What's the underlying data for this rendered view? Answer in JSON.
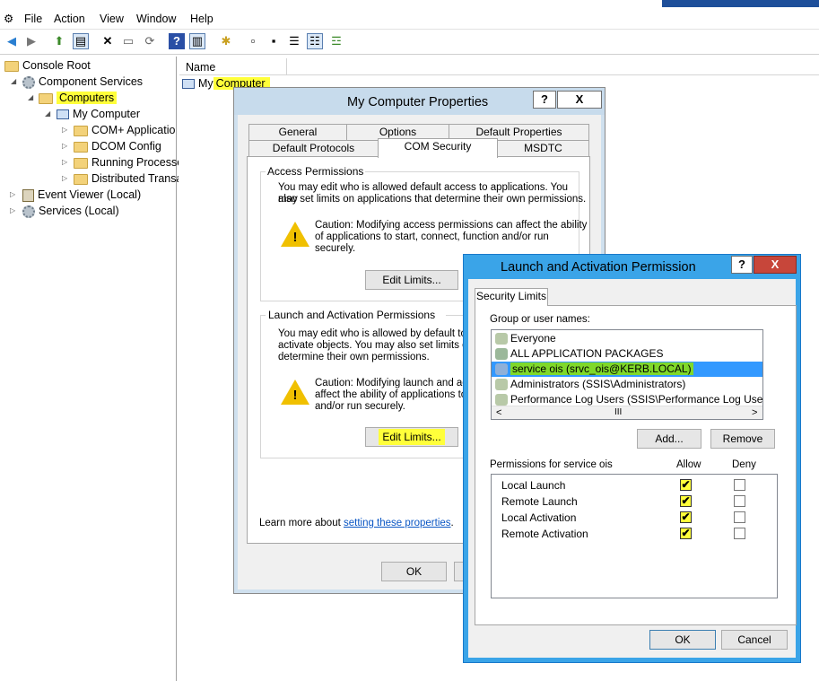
{
  "menu": {
    "file": "File",
    "action": "Action",
    "view": "View",
    "window": "Window",
    "help": "Help"
  },
  "tree": {
    "root": "Console Root",
    "component_services": "Component Services",
    "computers": "Computers",
    "my_computer": "My Computer",
    "com_apps": "COM+ Applicatio",
    "dcom_config": "DCOM Config",
    "running_processes": "Running Processe",
    "distributed_trans": "Distributed Transa",
    "event_viewer": "Event Viewer (Local)",
    "services": "Services (Local)"
  },
  "list": {
    "col_name": "Name",
    "row_my": "My",
    "row_computer": "Computer"
  },
  "props": {
    "title": "My Computer Properties",
    "help": "?",
    "close": "X",
    "tabs_top": [
      "General",
      "Options",
      "Default Properties"
    ],
    "tabs_bottom": [
      "Default Protocols",
      "COM Security",
      "MSDTC"
    ],
    "access_title": "Access Permissions",
    "access_text1": "You may edit who is allowed default access to applications. You may",
    "access_text2": "also set limits on applications that determine their own permissions.",
    "access_caution1": "Caution: Modifying access permissions can affect the ability",
    "access_caution2": "of applications to start, connect, function and/or run",
    "access_caution3": "securely.",
    "edit_limits": "Edit Limits...",
    "launch_title": "Launch and Activation Permissions",
    "launch_text1": "You may edit who is allowed by default to lau",
    "launch_text2": "activate objects. You may also set limits on a",
    "launch_text3": "determine their own permissions.",
    "launch_caution1": "Caution: Modifying launch and acti",
    "launch_caution2": "affect the ability of applications to s",
    "launch_caution3": "and/or run securely.",
    "learn_prefix": "Learn more about ",
    "learn_link": "setting these properties",
    "learn_suffix": ".",
    "ok": "OK"
  },
  "launch": {
    "title": "Launch and Activation Permission",
    "help": "?",
    "close": "X",
    "tab": "Security Limits",
    "group_label": "Group or user names:",
    "users": [
      "Everyone",
      "ALL APPLICATION PACKAGES",
      "service ois (srvc_ois@KERB.LOCAL)",
      "Administrators (SSIS\\Administrators)",
      "Performance Log Users (SSIS\\Performance Log Users)"
    ],
    "add": "Add...",
    "remove": "Remove",
    "perm_label": "Permissions for service ois",
    "allow": "Allow",
    "deny": "Deny",
    "perms": [
      {
        "name": "Local Launch",
        "allow": true,
        "deny": false
      },
      {
        "name": "Remote Launch",
        "allow": true,
        "deny": false
      },
      {
        "name": "Local Activation",
        "allow": true,
        "deny": false
      },
      {
        "name": "Remote Activation",
        "allow": true,
        "deny": false
      }
    ],
    "ok": "OK",
    "cancel": "Cancel",
    "scroll_up": "˄",
    "scroll_down": "˅",
    "scroll_left": "<",
    "scroll_right": ">",
    "scroll_thumb_v": "≡",
    "scroll_thumb_h": "III",
    "check": "✔"
  },
  "colors": {
    "highlight": "#ffff3a",
    "selected_green": "#7fd82a",
    "dialog_title": "#3aa4e8"
  }
}
